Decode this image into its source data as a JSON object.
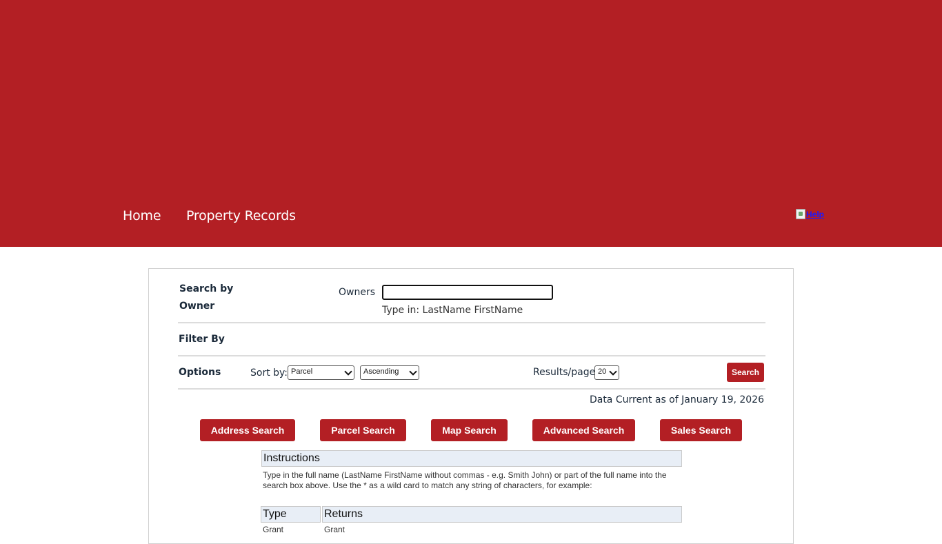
{
  "nav": {
    "home": "Home",
    "property_records": "Property Records",
    "help": "Help"
  },
  "search": {
    "heading": "Search by Owner",
    "owners_label": "Owners",
    "owners_value": "",
    "hint": "Type in: LastName FirstName"
  },
  "filter": {
    "label": "Filter By"
  },
  "options": {
    "label": "Options",
    "sort_label": "Sort by:",
    "sort_value": "Parcel",
    "order_value": "Ascending",
    "results_label": "Results/page:",
    "results_value": "20",
    "search_button": "Search"
  },
  "data_current": "Data Current as of January 19, 2026",
  "tabs": [
    "Address Search",
    "Parcel Search",
    "Map Search",
    "Advanced Search",
    "Sales Search"
  ],
  "instructions": {
    "title": "Instructions",
    "text": "Type in the full name (LastName FirstName without commas - e.g. Smith John) or part of the full name into the search box above. Use the * as a wild card to match any string of characters, for example:",
    "table_headers": [
      "Type",
      "Returns"
    ],
    "rows": [
      [
        "Grant",
        "Grant"
      ]
    ]
  },
  "colors": {
    "brand": "#b31f24",
    "table_header_bg": "#e8eef6"
  }
}
